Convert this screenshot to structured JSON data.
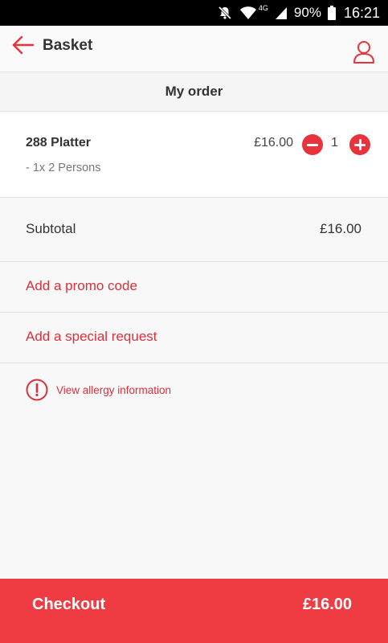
{
  "status_bar": {
    "battery": "90%",
    "network": "4G",
    "time": "16:21"
  },
  "header": {
    "title": "Basket"
  },
  "order": {
    "heading": "My order",
    "items": [
      {
        "name": "288 Platter",
        "option": "- 1x 2 Persons",
        "price": "£16.00",
        "quantity": "1"
      }
    ],
    "subtotal_label": "Subtotal",
    "subtotal_value": "£16.00"
  },
  "actions": {
    "promo_label": "Add a promo code",
    "special_label": "Add a special request",
    "allergy_label": "View allergy information"
  },
  "checkout": {
    "label": "Checkout",
    "total": "£16.00"
  },
  "colors": {
    "accent": "#e8323c",
    "checkout_bg": "#ef3b42",
    "link": "#d9303a"
  }
}
